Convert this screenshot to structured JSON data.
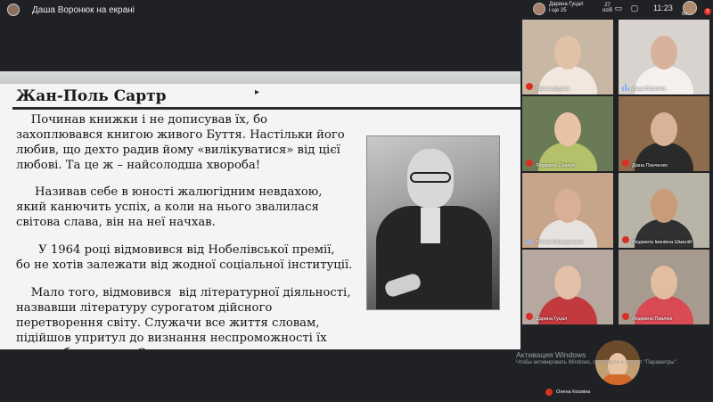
{
  "presenter": {
    "label": "Даша Воронюк на екрані"
  },
  "slide": {
    "title": "Жан-Поль Сартр",
    "paragraphs": [
      "    Починав книжки і не дописував їх, бо\nзахоплювався книгою живого Буття. Настільки його\nлюбив, що дехто радив йому «вилікуватися» від цієї\nлюбові. Та це ж – найсолодша хвороба!",
      "     Називав себе в юності жалюгідним невдахою,\nякий канючить успіх, а коли на нього звалилася\nсвітова слава, він на неї начхав.",
      "      У 1964 році відмовився від Нобелівської премії,\nбо не хотів залежати від жодної соціальної інституції.",
      "    Мало того, відмовився  від літературної діяльності,\nназвавши літературу сурогатом дійсного\nперетворення світу. Служачи все життя словам,\nпідійшов упритул до визнання неспроможності їх\nперед абсолютним Словом"
    ]
  },
  "topright": {
    "user_name": "Дарина Гуцал",
    "user_sub": "і ще 25",
    "participant_count": "27",
    "participant_sub": "осіб",
    "time": "11:23",
    "me_label": "Ви",
    "me_badge": "5"
  },
  "participants": [
    {
      "name": "Лариса Дудник",
      "muted": true,
      "colors": {
        "bg": "#c8b7a4",
        "face": "#e2c2a6",
        "body": "#f2e7df"
      }
    },
    {
      "name": "Даша Воронюк",
      "muted": false,
      "colors": {
        "bg": "#d9d3cf",
        "face": "#d8b19c",
        "body": "#f4f0ee"
      }
    },
    {
      "name": "Людмила Савлук",
      "muted": true,
      "colors": {
        "bg": "#6a7a56",
        "face": "#e7c2a4",
        "body": "#b5c06b"
      }
    },
    {
      "name": "Діана Панченко",
      "muted": true,
      "colors": {
        "bg": "#8f6b4e",
        "face": "#d8b39a",
        "body": "#2a2a2a"
      }
    },
    {
      "name": "Тетяна Капищинская",
      "muted": false,
      "colors": {
        "bg": "#c6a58a",
        "face": "#d9b097",
        "body": "#e8e2de"
      }
    },
    {
      "name": "Людмила Іванівна Шмалій",
      "muted": true,
      "colors": {
        "bg": "#b8b5a8",
        "face": "#c99c79",
        "body": "#303030"
      }
    },
    {
      "name": "Дарина Гуцал",
      "muted": true,
      "colors": {
        "bg": "#b6a79f",
        "face": "#e5c0a8",
        "body": "#c23a3e"
      }
    },
    {
      "name": "Людмила Павлюк",
      "muted": true,
      "colors": {
        "bg": "#a69b8e",
        "face": "#e2bda0",
        "body": "#d94a55"
      }
    }
  ],
  "big_tile": {
    "name": "Олена Косміна"
  },
  "watermark": {
    "line1": "Активация Windows",
    "line2": "Чтобы активировать Windows, перейдите в раздел \"Параметры\"."
  }
}
